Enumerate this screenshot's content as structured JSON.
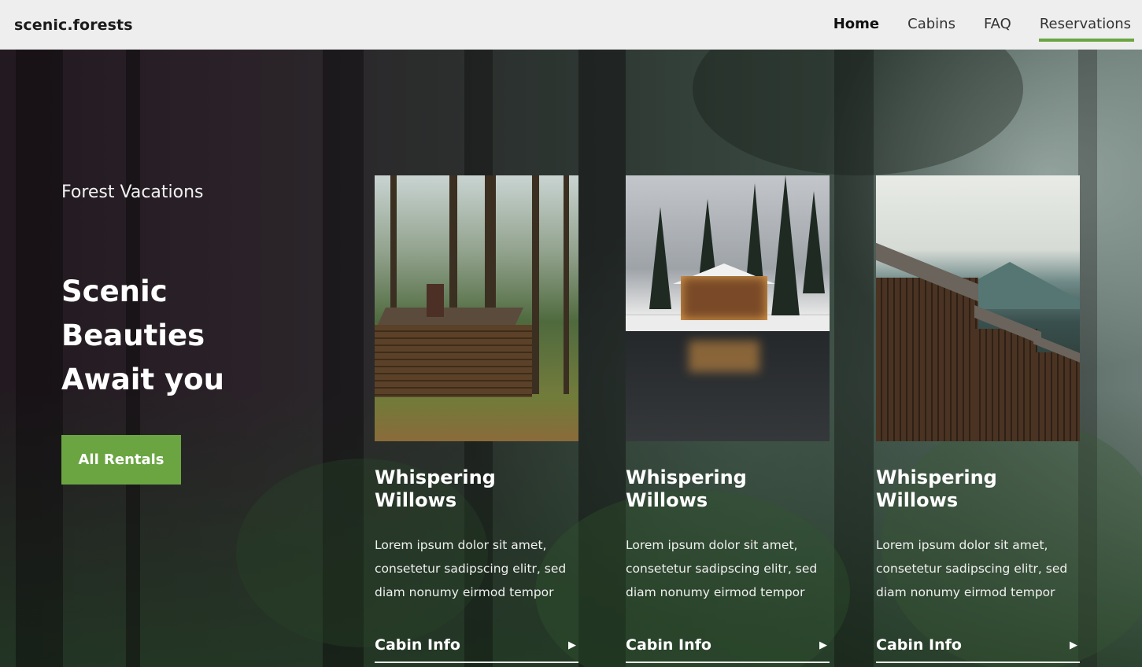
{
  "header": {
    "brand": "scenic.forests",
    "nav": [
      {
        "label": "Home",
        "active": true
      },
      {
        "label": "Cabins",
        "active": false
      },
      {
        "label": "FAQ",
        "active": false
      },
      {
        "label": "Reservations",
        "active": false
      }
    ]
  },
  "hero": {
    "eyebrow": "Forest Vacations",
    "headline_lines": [
      "Scenic",
      "Beauties",
      "Await you"
    ],
    "button_label": "All Rentals"
  },
  "cards": [
    {
      "title": "Whispering Willows",
      "description": "Lorem ipsum dolor sit amet, consetetur sadipscing elitr, sed diam nonumy eirmod tempor",
      "link_label": "Cabin Info",
      "image": "forest-cabin-photo"
    },
    {
      "title": "Whispering Willows",
      "description": "Lorem ipsum dolor sit amet, consetetur sadipscing elitr, sed diam nonumy eirmod tempor",
      "link_label": "Cabin Info",
      "image": "snowy-lake-cabin-photo"
    },
    {
      "title": "Whispering Willows",
      "description": "Lorem ipsum dolor sit amet, consetetur sadipscing elitr, sed diam nonumy eirmod tempor",
      "link_label": "Cabin Info",
      "image": "mountain-cabins-photo"
    }
  ],
  "colors": {
    "accent": "#6aa542",
    "header_bg": "#eeeeee",
    "text_light": "#ffffff"
  },
  "icons": {
    "card_link_arrow": "play-arrow-icon"
  }
}
